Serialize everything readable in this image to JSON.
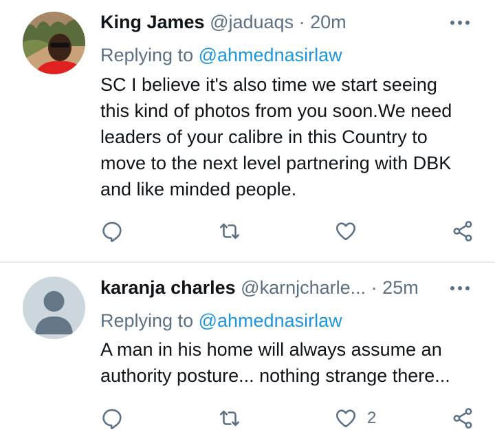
{
  "tweets": [
    {
      "name": "King James",
      "handle": "@jaduaqs",
      "separator": "·",
      "time": "20m",
      "replying_prefix": "Replying to",
      "replying_to": "@ahmednasirlaw",
      "body_lines": [
        "SC I believe it's also time we start seeing",
        "this kind of photos from you soon.We need",
        "leaders of your calibre in this Country to",
        "move to the next level partnering with DBK",
        "and like minded people."
      ],
      "avatar": "photo-avatar",
      "like_count": ""
    },
    {
      "name": "karanja charles",
      "handle": "@karnjcharle...",
      "separator": "·",
      "time": "25m",
      "replying_prefix": "Replying to",
      "replying_to": "@ahmednasirlaw",
      "body_lines": [
        "A man in his home will always assume an",
        "authority posture... nothing strange there..."
      ],
      "avatar": "default-avatar",
      "like_count": "2"
    }
  ],
  "icons": {
    "reply": "reply-icon",
    "retweet": "retweet-icon",
    "like": "heart-icon",
    "share": "share-icon",
    "more": "more-options-icon"
  },
  "colors": {
    "text": "#0f1419",
    "secondary": "#5b7083",
    "link": "#1b95e0",
    "divider": "#e6ecf0",
    "default_avatar_bg": "#ccd6dd",
    "default_avatar_fg": "#657786"
  }
}
